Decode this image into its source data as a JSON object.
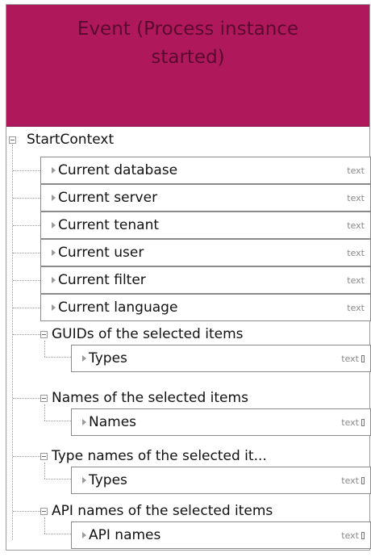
{
  "header": {
    "title": "Event (Process instance\nstarted)"
  },
  "root": {
    "label": "StartContext"
  },
  "fields": [
    {
      "label": "Current database",
      "type": "text"
    },
    {
      "label": "Current server",
      "type": "text"
    },
    {
      "label": "Current tenant",
      "type": "text"
    },
    {
      "label": "Current user",
      "type": "text"
    },
    {
      "label": "Current filter",
      "type": "text"
    },
    {
      "label": "Current language",
      "type": "text"
    }
  ],
  "groups": [
    {
      "label": "GUIDs of the selected items",
      "child": {
        "label": "Types",
        "type": "text"
      }
    },
    {
      "label": "Names of the selected items",
      "child": {
        "label": "Names",
        "type": "text"
      }
    },
    {
      "label": "Type names of the selected it...",
      "child": {
        "label": "Types",
        "type": "text"
      }
    },
    {
      "label": "API names of the selected items",
      "child": {
        "label": "API names",
        "type": "text"
      }
    }
  ],
  "colors": {
    "header": "#b0185c",
    "header_text": "#5a0a2e",
    "border": "#8a8a8a"
  }
}
